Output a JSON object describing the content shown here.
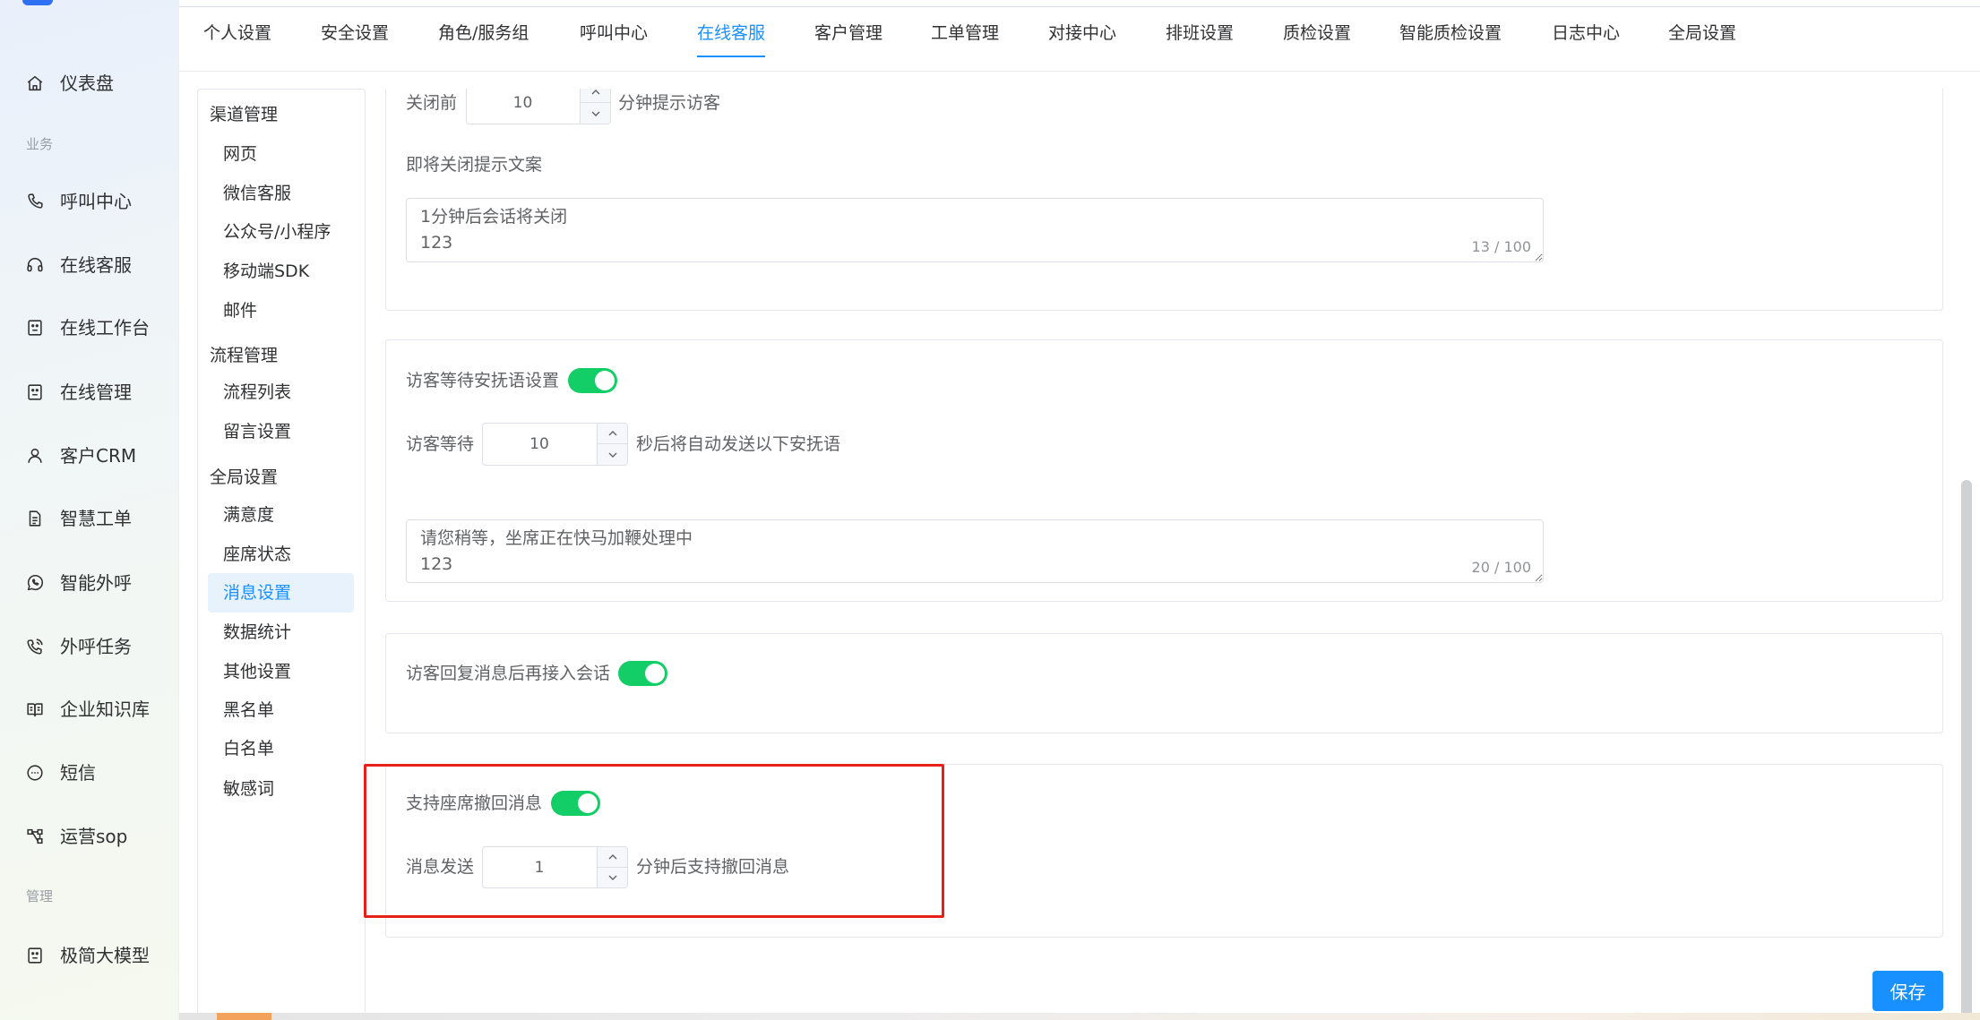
{
  "logo": {
    "icon": "logo-mark"
  },
  "colors": {
    "accent": "#1890ff",
    "switch_on": "#13ce66",
    "annotation": "#e8201a",
    "active_bg": "#e8f2fd"
  },
  "sidebar": {
    "sections": [
      {
        "label": "业务"
      },
      {
        "label": "管理"
      }
    ],
    "items": [
      {
        "label": "仪表盘",
        "icon": "home-icon"
      },
      {
        "label": "呼叫中心",
        "icon": "phone-icon"
      },
      {
        "label": "在线客服",
        "icon": "headset-icon"
      },
      {
        "label": "在线工作台",
        "icon": "workbench-icon"
      },
      {
        "label": "在线管理",
        "icon": "monitor-icon"
      },
      {
        "label": "客户CRM",
        "icon": "user-icon"
      },
      {
        "label": "智慧工单",
        "icon": "ticket-icon"
      },
      {
        "label": "智能外呼",
        "icon": "chat-call-icon"
      },
      {
        "label": "外呼任务",
        "icon": "phone-outgoing-icon"
      },
      {
        "label": "企业知识库",
        "icon": "book-icon"
      },
      {
        "label": "短信",
        "icon": "sms-icon"
      },
      {
        "label": "运营sop",
        "icon": "flow-icon"
      },
      {
        "label": "极简大模型",
        "icon": "model-icon"
      }
    ]
  },
  "tabs": {
    "active_index": 4,
    "items": [
      {
        "label": "个人设置"
      },
      {
        "label": "安全设置"
      },
      {
        "label": "角色/服务组"
      },
      {
        "label": "呼叫中心"
      },
      {
        "label": "在线客服"
      },
      {
        "label": "客户管理"
      },
      {
        "label": "工单管理"
      },
      {
        "label": "对接中心"
      },
      {
        "label": "排班设置"
      },
      {
        "label": "质检设置"
      },
      {
        "label": "智能质检设置"
      },
      {
        "label": "日志中心"
      },
      {
        "label": "全局设置"
      }
    ]
  },
  "sub_menu": {
    "active": {
      "group": 2,
      "item": 2
    },
    "groups": [
      {
        "title": "渠道管理",
        "items": [
          "网页",
          "微信客服",
          "公众号/小程序",
          "移动端SDK",
          "邮件"
        ]
      },
      {
        "title": "流程管理",
        "items": [
          "流程列表",
          "留言设置"
        ]
      },
      {
        "title": "全局设置",
        "items": [
          "满意度",
          "座席状态",
          "消息设置",
          "数据统计",
          "其他设置",
          "黑名单",
          "白名单",
          "敏感词"
        ]
      }
    ]
  },
  "settings": {
    "close_prompt": {
      "prefix": "关闭前",
      "value": "10",
      "suffix": "分钟提示访客",
      "message_label": "即将关闭提示文案",
      "message": "1分钟后会话将关闭\n123",
      "counter": "13 / 100"
    },
    "wait_comfort": {
      "label": "访客等待安抚语设置",
      "enabled": true,
      "prefix": "访客等待",
      "value": "10",
      "suffix": "秒后将自动发送以下安抚语",
      "message": "请您稍等，坐席正在快马加鞭处理中\n123",
      "counter": "20 / 100"
    },
    "reply_reconnect": {
      "label": "访客回复消息后再接入会话",
      "enabled": true
    },
    "recall": {
      "label": "支持座席撤回消息",
      "enabled": true,
      "prefix": "消息发送",
      "value": "1",
      "suffix": "分钟后支持撤回消息"
    }
  },
  "actions": {
    "save_label": "保存"
  }
}
